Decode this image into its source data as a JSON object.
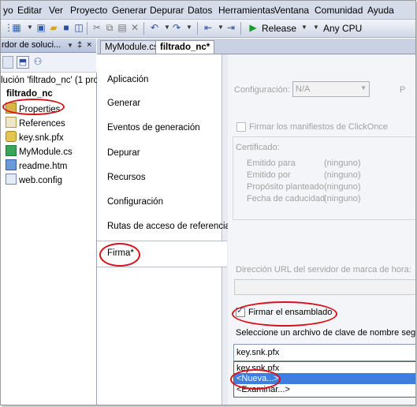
{
  "menu": [
    "yo",
    "Editar",
    "Ver",
    "Proyecto",
    "Generar",
    "Depurar",
    "Datos",
    "Herramientas",
    "Ventana",
    "Comunidad",
    "Ayuda"
  ],
  "toolbar": {
    "configuration": "Release",
    "platform": "Any CPU"
  },
  "solution_explorer": {
    "title": "rdor de soluci...",
    "pin": "‡",
    "close": "×",
    "solution_label": "lución 'filtrado_nc' (1 pro",
    "project": "filtrado_nc",
    "items": [
      "Properties",
      "References",
      "key.snk.pfx",
      "MyModule.cs",
      "readme.htm",
      "web.config"
    ]
  },
  "tabs": [
    "MyModule.cs",
    "filtrado_nc*"
  ],
  "nav": [
    "Aplicación",
    "Generar",
    "Eventos de generación",
    "Depurar",
    "Recursos",
    "Configuración",
    "Rutas de acceso de referencia",
    "Firma*"
  ],
  "signing": {
    "config_label": "Configuración:",
    "config_value": "N/A",
    "clickonce_label": "Firmar los manifiestos de ClickOnce",
    "certificate_label": "Certificado:",
    "cert_rows": [
      {
        "k": "Emitido para",
        "v": "(ninguno)"
      },
      {
        "k": "Emitido por",
        "v": "(ninguno)"
      },
      {
        "k": "Propósito planteado",
        "v": "(ninguno)"
      },
      {
        "k": "Fecha de caducidad",
        "v": "(ninguno)"
      }
    ],
    "timestamp_label": "Dirección URL del servidor de marca de hora:",
    "sign_assembly_label": "Firmar el ensamblado",
    "keyfile_label": "Seleccione un archivo de clave de nombre seguro:",
    "keyfile_value": "key.snk.pfx",
    "dropdown_options": [
      "key.snk.pfx",
      "<Nueva...>",
      "<Examinar...>"
    ]
  },
  "colors": {
    "highlight": "#3d7ee0",
    "annotation": "#d8121a"
  }
}
